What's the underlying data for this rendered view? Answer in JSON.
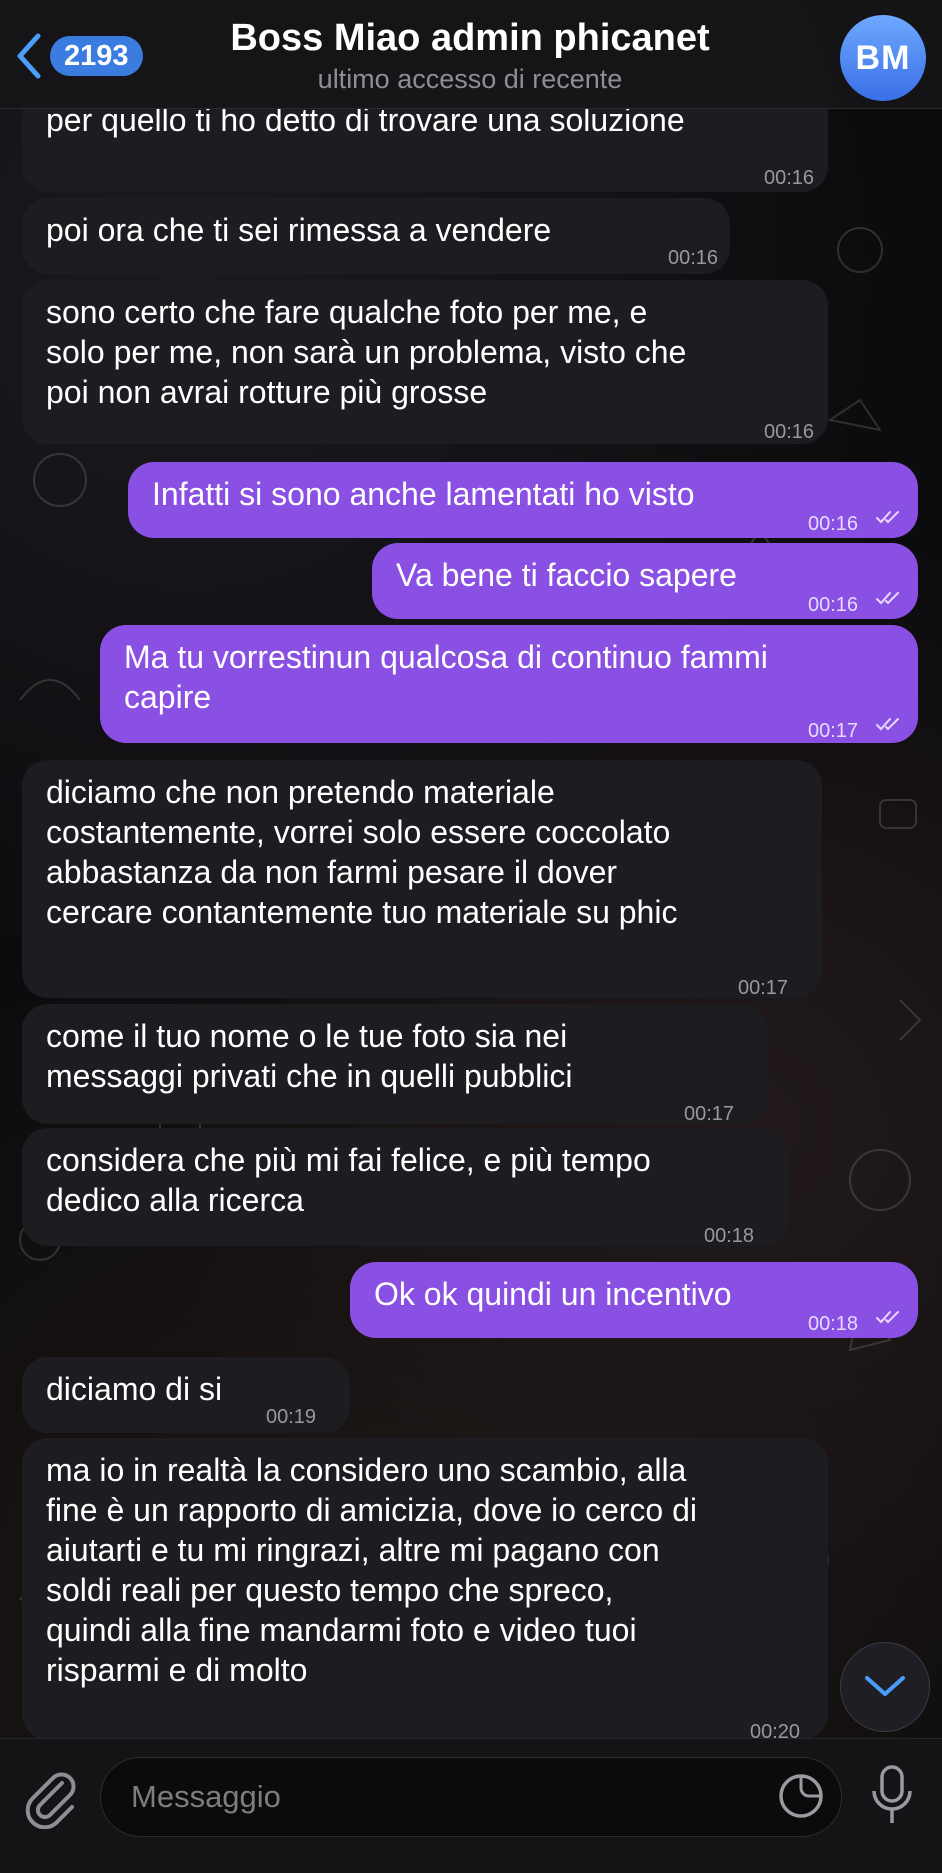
{
  "header": {
    "unread_count": "2193",
    "title": "Boss Miao admin phicanet",
    "status": "ultimo accesso di recente",
    "avatar_initials": "BM",
    "back_icon": "chevron-left-icon"
  },
  "messages": [
    {
      "dir": "in",
      "text": "per quello ti ho detto di trovare una soluzione",
      "time": "00:16"
    },
    {
      "dir": "in",
      "text": "poi ora che ti sei rimessa a vendere",
      "time": "00:16"
    },
    {
      "dir": "in",
      "text": "sono certo che fare qualche foto per me, e\nsolo per me, non sarà un problema, visto che\npoi non avrai rotture più grosse",
      "time": "00:16"
    },
    {
      "dir": "out",
      "text": "Infatti si sono anche lamentati ho visto",
      "time": "00:16",
      "read": true
    },
    {
      "dir": "out",
      "text": "Va bene ti faccio sapere",
      "time": "00:16",
      "read": true
    },
    {
      "dir": "out",
      "text": "Ma tu vorrestinun qualcosa di continuo fammi\ncapire",
      "time": "00:17",
      "read": true
    },
    {
      "dir": "in",
      "text": "diciamo che non pretendo materiale\ncostantemente, vorrei solo essere coccolato\nabbastanza da non farmi pesare il dover\ncercare contantemente tuo materiale su phic",
      "time": "00:17"
    },
    {
      "dir": "in",
      "text": "come il tuo nome o le tue foto sia nei\nmessaggi privati che in quelli pubblici",
      "time": "00:17"
    },
    {
      "dir": "in",
      "text": "considera che più mi fai felice, e più tempo\ndedico alla ricerca",
      "time": "00:18"
    },
    {
      "dir": "out",
      "text": "Ok ok quindi un incentivo",
      "time": "00:18",
      "read": true
    },
    {
      "dir": "in",
      "text": "diciamo di si",
      "time": "00:19"
    },
    {
      "dir": "in",
      "text": "ma io in realtà la considero uno scambio, alla\nfine è un rapporto di amicizia, dove io cerco di\naiutarti e tu mi ringrazi, altre mi pagano con\nsoldi reali per questo tempo che spreco,\nquindi alla fine mandarmi foto e video tuoi\nrisparmi e di molto",
      "time": "00:20"
    }
  ],
  "composer": {
    "placeholder": "Messaggio",
    "attach_icon": "paperclip-icon",
    "sticker_icon": "sticker-icon",
    "mic_icon": "microphone-icon"
  },
  "scroll_down_icon": "chevron-down-icon",
  "colors": {
    "outgoing_bubble": "#8a4fe3",
    "incoming_bubble": "#1d1c21",
    "badge": "#3a7ce0",
    "avatar": "#4f86f0"
  }
}
